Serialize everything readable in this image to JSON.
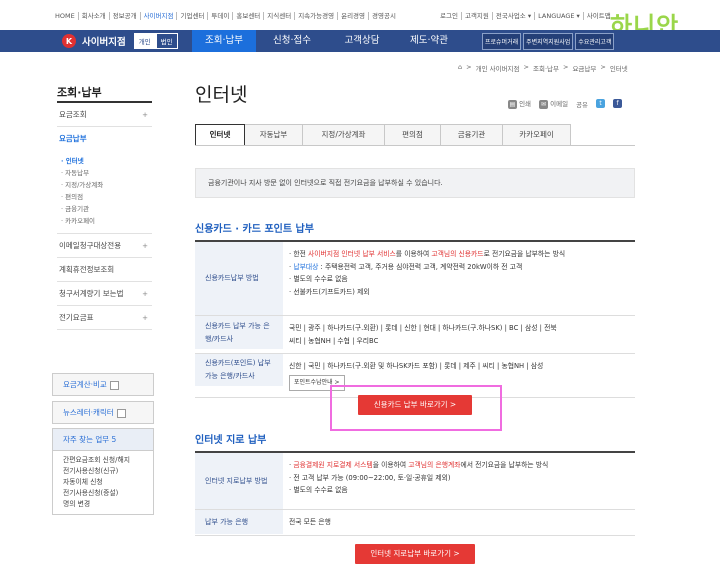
{
  "top_links": [
    "HOME",
    "회사소개",
    "정보공개",
    "사이버지점",
    "기업센터",
    "투데이",
    "홍보센터",
    "지식센터",
    "지속가능경영",
    "윤리경영",
    "경영공시"
  ],
  "top_right": [
    "로그인",
    "고객지원",
    "전국사업소 ▾",
    "LANGUAGE ▾",
    "사이트맵"
  ],
  "watermark": "하니안",
  "logo": {
    "mark": "K",
    "text": "사이버지점",
    "seg_on": "개인",
    "seg_off": "법인"
  },
  "menu": [
    "조회·납부",
    "신청·접수",
    "고객상담",
    "제도·약관"
  ],
  "gnb_buttons": [
    "프로슈머거래",
    "주변지역지원사업",
    "수요관리고객"
  ],
  "sidebar": {
    "title": "조회·납부",
    "items_before": [
      {
        "label": "요금조회",
        "plus": "+"
      }
    ],
    "active": "요금납부",
    "sub": [
      "인터넷",
      "자동납부",
      "지정/가상계좌",
      "편의점",
      "금융기관",
      "카카오페이"
    ],
    "items_after": [
      {
        "label": "이메일청구대상전용",
        "plus": "+"
      },
      {
        "label": "계획휴전정보조회",
        "plus": ""
      },
      {
        "label": "청구서계량기 보는법",
        "plus": "+"
      },
      {
        "label": "전기요금표",
        "plus": "+"
      }
    ],
    "box1": "요금계산·비교",
    "box2": "뉴스레터·캐릭터",
    "faq_title": "자주 찾는 업무 5",
    "faq": [
      "간편요금조회 신청/해지",
      "전기사용신청(신규)",
      "자동이체 신청",
      "전기사용신청(증설)",
      "명의 변경"
    ]
  },
  "breadcrumb": [
    "⌂",
    ">",
    "개인 사이버지점",
    ">",
    "조회·납부",
    ">",
    "요금납부",
    ">",
    "인터넷"
  ],
  "page_title": "인터넷",
  "tools": {
    "print": "인쇄",
    "email": "이메일",
    "share": "공유"
  },
  "tabs": [
    "인터넷",
    "자동납부",
    "지정/가상계좌",
    "편의점",
    "금융기관",
    "카카오페이"
  ],
  "notice": "금융기관이나 지사 방문 없이 인터넷으로 직접 전기요금을 납부하실 수 있습니다.",
  "card": {
    "heading": "신용카드 · 카드 포인트 납부",
    "rows": [
      {
        "th": "신용카드납부 방법",
        "lines": [
          [
            "· 한전 ",
            {
              "red": "사이버지점 인터넷 납부 서비스"
            },
            "를 이용하여 ",
            {
              "red": "고객님의 신용카드"
            },
            "로 전기요금을 납부하는 방식"
          ],
          [
            "· ",
            {
              "blue": "납부대상"
            },
            " : 주택용전력 고객, 주거용 심야전력 고객, 계약전력 20kW이하 전 고객"
          ],
          [
            "· 별도의 수수료 없음"
          ],
          [
            "· 선불카드(기프트카드) 제외"
          ]
        ]
      },
      {
        "th": "신용카드 납부 가능 은행/카드사",
        "lines": [
          [
            "국민 | 광주 | 하나카드(구.외환) | 롯데 | 신한 | 현대 | 하나카드(구.하나SK) | BC | 삼성 | 전북"
          ],
          [
            "씨티 | 농협NH | 수협 | 우리BC"
          ]
        ]
      },
      {
        "th": "신용카드(포인트) 납부 가능 은행/카드사",
        "lines": [
          [
            "신한 | 국민 | 하나카드(구.외환 및 하나SK카드 포함) | 롯데 | 제주 | 씨티 | 농협NH | 삼성"
          ]
        ],
        "button": "포인트수납안내 >"
      }
    ],
    "go": "신용카드 납부 바로가기 >"
  },
  "bank": {
    "heading": "인터넷 지로 납부",
    "rows": [
      {
        "th": "인터넷 지로납부 방법",
        "lines": [
          [
            "· ",
            {
              "red": "금융결제원 지로결제 서스템"
            },
            "을 이용하여 ",
            {
              "red": "고객님의 은행계좌"
            },
            "에서 전기요금을 납부하는 방식"
          ],
          [
            "· 전 고객 납부 가능 (09:00~22:00, 토·일·공휴일 제외)"
          ],
          [
            "· 별도의 수수료 없음"
          ]
        ]
      },
      {
        "th": "납부 가능 은행",
        "lines": [
          [
            "전국 모든 은행"
          ]
        ]
      }
    ],
    "go": "인터넷 지로납부 바로가기 >"
  }
}
